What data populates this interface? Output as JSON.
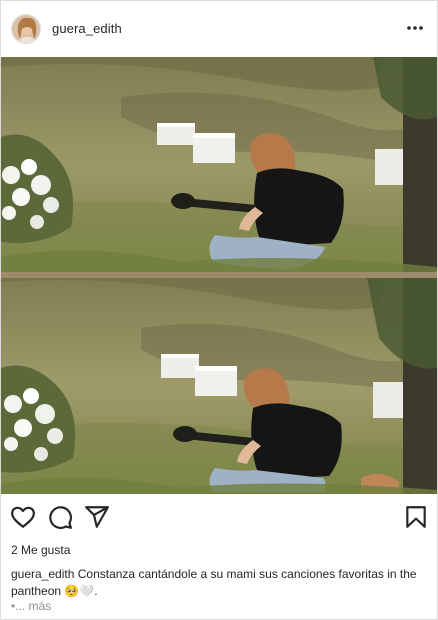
{
  "post": {
    "username": "guera_edith",
    "more_icon": "more-horizontal-icon",
    "likes_text": "2 Me gusta",
    "caption_user": "guera_edith",
    "caption_text": "Constanza cantándole a su mami sus canciones favoritas in the pantheon 🥺🤍.",
    "more_text": "•... más"
  },
  "actions": {
    "like_icon": "heart-icon",
    "comment_icon": "comment-icon",
    "share_icon": "share-icon",
    "save_icon": "bookmark-icon"
  },
  "colors": {
    "text": "#262626",
    "muted": "#8e8e8e",
    "border": "#dbdbdb",
    "grass": "#8d8a5a"
  }
}
